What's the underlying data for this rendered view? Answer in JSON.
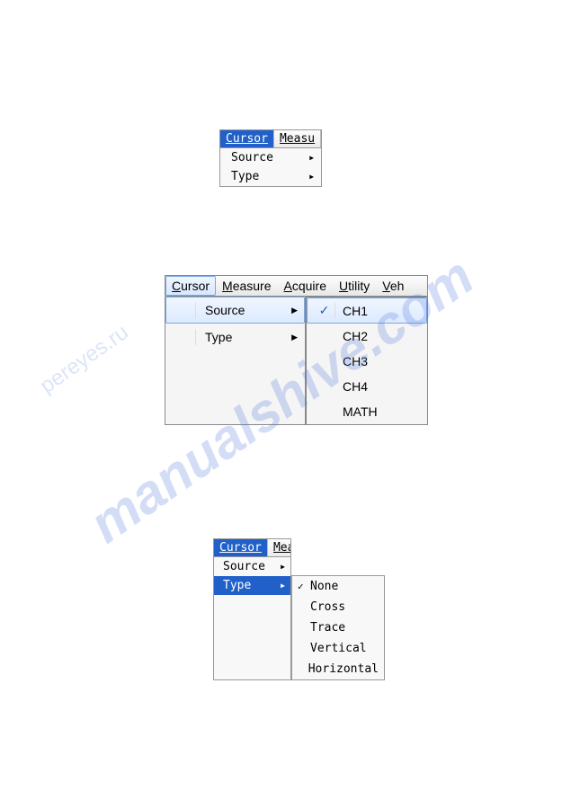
{
  "watermark": "manualshive.com",
  "watermark2": "pereyes.ru",
  "menu1": {
    "bar": {
      "cursor": "Cursor",
      "measure": "Measu"
    },
    "items": {
      "source": "Source",
      "type": "Type"
    }
  },
  "menu2": {
    "bar": {
      "cursor": "Cursor",
      "measure": "Measure",
      "acquire": "Acquire",
      "utility": "Utility",
      "vehicle": "Veh"
    },
    "items": {
      "source": "Source",
      "type": "Type"
    },
    "submenu": [
      "CH1",
      "CH2",
      "CH3",
      "CH4",
      "MATH"
    ]
  },
  "menu3": {
    "bar": {
      "cursor": "Cursor",
      "measure": "Measu"
    },
    "items": {
      "source": "Source",
      "type": "Type"
    },
    "submenu": [
      "None",
      "Cross",
      "Trace",
      "Vertical",
      "Horizontal"
    ]
  }
}
